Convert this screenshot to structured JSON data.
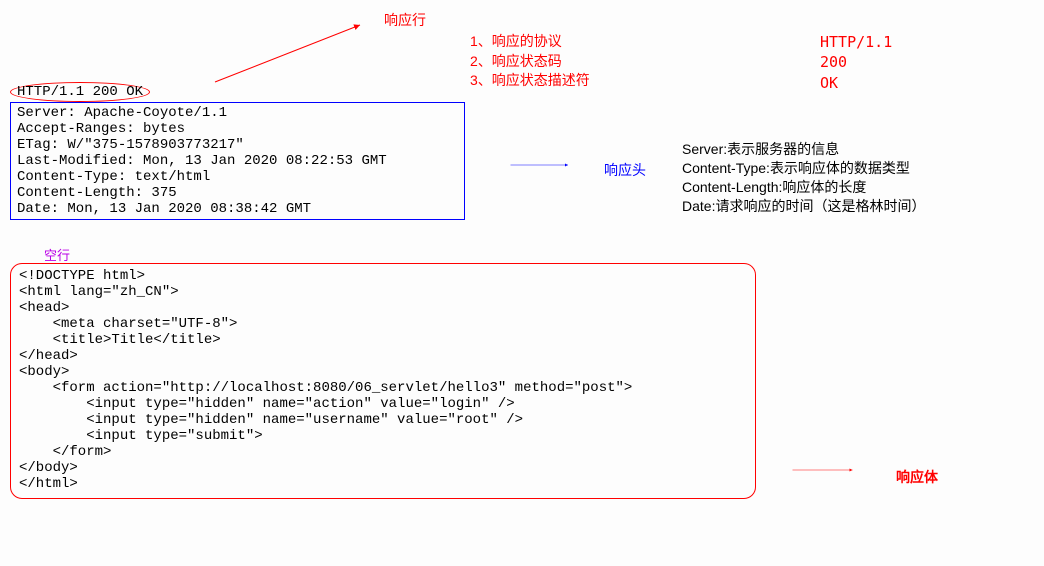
{
  "labels": {
    "response_line": "响应行",
    "response_headers": "响应头",
    "response_body": "响应体",
    "empty_line": "空行"
  },
  "status_line": "HTTP/1.1 200 OK",
  "status_desc": {
    "item1": "1、响应的协议",
    "item2": "2、响应状态码",
    "item3": "3、响应状态描述符",
    "val1": "HTTP/1.1",
    "val2": "200",
    "val3": "OK"
  },
  "headers": {
    "line1": "Server: Apache-Coyote/1.1",
    "line2": "Accept-Ranges: bytes",
    "line3": "ETag: W/\"375-1578903773217\"",
    "line4": "Last-Modified: Mon, 13 Jan 2020 08:22:53 GMT",
    "line5": "Content-Type: text/html",
    "line6": "Content-Length: 375",
    "line7": "Date: Mon, 13 Jan 2020 08:38:42 GMT"
  },
  "header_desc": {
    "line1": "Server:表示服务器的信息",
    "line2": "Content-Type:表示响应体的数据类型",
    "line3": "Content-Length:响应体的长度",
    "line4": "Date:请求响应的时间（这是格林时间）"
  },
  "body": {
    "l1": "<!DOCTYPE html>",
    "l2": "<html lang=\"zh_CN\">",
    "l3": "<head>",
    "l4": "    <meta charset=\"UTF-8\">",
    "l5": "    <title>Title</title>",
    "l6": "</head>",
    "l7": "<body>",
    "l8": "    <form action=\"http://localhost:8080/06_servlet/hello3\" method=\"post\">",
    "l9": "        <input type=\"hidden\" name=\"action\" value=\"login\" />",
    "l10": "        <input type=\"hidden\" name=\"username\" value=\"root\" />",
    "l11": "        <input type=\"submit\">",
    "l12": "    </form>",
    "l13": "</body>",
    "l14": "</html>"
  }
}
